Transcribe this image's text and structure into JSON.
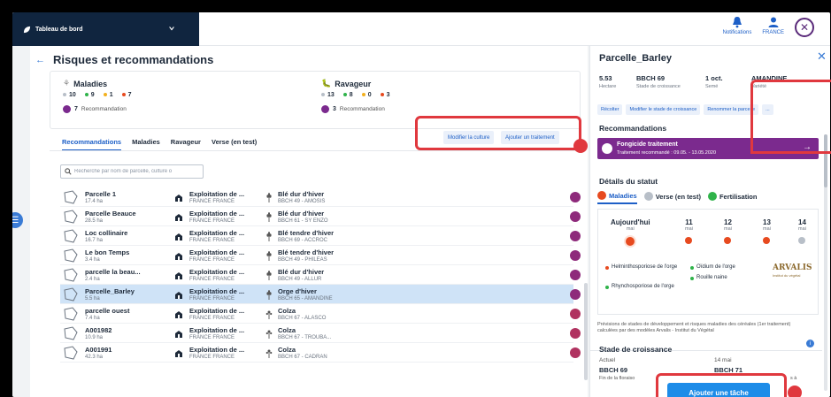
{
  "topbar": {
    "dashboard": "Tableau de bord",
    "notifications": "Notifications",
    "country": "FRANCE"
  },
  "main": {
    "title": "Risques et recommandations",
    "summary": {
      "maladies": {
        "title": "Maladies",
        "counts": [
          "10",
          "9",
          "1",
          "7"
        ],
        "reco_count": "7",
        "reco_label": "Recommandation"
      },
      "ravageur": {
        "title": "Ravageur",
        "counts": [
          "13",
          "8",
          "0",
          "3"
        ],
        "reco_count": "3",
        "reco_label": "Recommandation"
      }
    },
    "tabs": [
      "Recommandations",
      "Maladies",
      "Ravageur",
      "Verse (en test)"
    ],
    "search_placeholder": "Recherche par nom de parcelle, culture o",
    "buttons": {
      "modify_crop": "Modifier la culture",
      "add_treatment": "Ajouter un traitement"
    },
    "rows": [
      {
        "name": "Parcelle 1",
        "size": "17.4 ha",
        "farm": "Exploitation de ...",
        "farm_sub": "FRANCE FRANCE",
        "crop": "Blé dur d'hiver",
        "crop_sub": "BBCH 49 - AMOSIS",
        "type": "cereal"
      },
      {
        "name": "Parcelle Beauce",
        "size": "28.5 ha",
        "farm": "Exploitation de ...",
        "farm_sub": "FRANCE FRANCE",
        "crop": "Blé dur d'hiver",
        "crop_sub": "BBCH 61 - SY ENZO",
        "type": "cereal"
      },
      {
        "name": "Loc collinaire",
        "size": "16.7 ha",
        "farm": "Exploitation de ...",
        "farm_sub": "FRANCE FRANCE",
        "crop": "Blé tendre d'hiver",
        "crop_sub": "BBCH 69 - ACCROC",
        "type": "cereal"
      },
      {
        "name": "Le bon Temps",
        "size": "3.4 ha",
        "farm": "Exploitation de ...",
        "farm_sub": "FRANCE FRANCE",
        "crop": "Blé tendre d'hiver",
        "crop_sub": "BBCH 49 - PHILEAS",
        "type": "cereal"
      },
      {
        "name": "parcelle la beau...",
        "size": "2.4 ha",
        "farm": "Exploitation de ...",
        "farm_sub": "FRANCE FRANCE",
        "crop": "Blé dur d'hiver",
        "crop_sub": "BBCH 49 - ALLUR",
        "type": "cereal"
      },
      {
        "name": "Parcelle_Barley",
        "size": "5.5 ha",
        "farm": "Exploitation de ...",
        "farm_sub": "FRANCE FRANCE",
        "crop": "Orge d'hiver",
        "crop_sub": "BBCH 65 - AMANDINE",
        "type": "cereal",
        "selected": true
      },
      {
        "name": "parcelle ouest",
        "size": "7.4 ha",
        "farm": "Exploitation de ...",
        "farm_sub": "FRANCE FRANCE",
        "crop": "Colza",
        "crop_sub": "BBCH 67 - ALASCO",
        "type": "colza"
      },
      {
        "name": "A001982",
        "size": "10.9 ha",
        "farm": "Exploitation de ...",
        "farm_sub": "FRANCE FRANCE",
        "crop": "Colza",
        "crop_sub": "BBCH 67 - TROUBA...",
        "type": "colza"
      },
      {
        "name": "A001991",
        "size": "42.3 ha",
        "farm": "Exploitation de ...",
        "farm_sub": "FRANCE FRANCE",
        "crop": "Colza",
        "crop_sub": "BBCH 67 - CADRAN",
        "type": "colza"
      }
    ]
  },
  "side": {
    "title": "Parcelle_Barley",
    "meta": [
      {
        "value": "5.53",
        "label": "Hectare"
      },
      {
        "value": "BBCH 69",
        "label": "Stade de croissance"
      },
      {
        "value": "1 oct.",
        "label": "Semé"
      },
      {
        "value": "AMANDINE",
        "label": "Variété"
      }
    ],
    "buttons": [
      "Récolter",
      "Modifier le stade de croissance",
      "Renommer la parcelle",
      "..."
    ],
    "reco_title": "Recommandations",
    "reco_banner": {
      "title": "Fongicide traitement",
      "sub": "Traitement recommandé : 09.05. - 13.05.2020"
    },
    "status_title": "Détails du statut",
    "status_tabs": [
      "Maladies",
      "Verse (en test)",
      "Fertilisation"
    ],
    "days": [
      {
        "d": "Aujourd'hui",
        "m": "mai"
      },
      {
        "d": "11",
        "m": "mai"
      },
      {
        "d": "12",
        "m": "mai"
      },
      {
        "d": "13",
        "m": "mai"
      },
      {
        "d": "14",
        "m": "mai"
      }
    ],
    "legend": [
      "Helminthosporiose de l'orge",
      "Oïdium de l'orge",
      "Rouille naine",
      "Rhynchosporiose de l'orge"
    ],
    "brand": "ARVALIS",
    "brand_sub": "Institut du végétal",
    "prevision": "Prévisions de stades de développement et risques maladies des céréales (1er traitement) calculées par des modèles Arvalis - Institut du Végétal",
    "growth_title": "Stade de croissance",
    "growth": {
      "current_label": "Actuel",
      "current_value": "BBCH 69",
      "current_sub": "Fin de la floraiso",
      "next_date": "14 mai",
      "next_value": "BBCH 71",
      "next_sub": "s à"
    },
    "add_task": "Ajouter une tâche"
  },
  "colors": {
    "accent": "#1d5fc7",
    "purple": "#7b2a8e",
    "highlight": "#e0383e",
    "selected_row": "#cfe3f7"
  }
}
